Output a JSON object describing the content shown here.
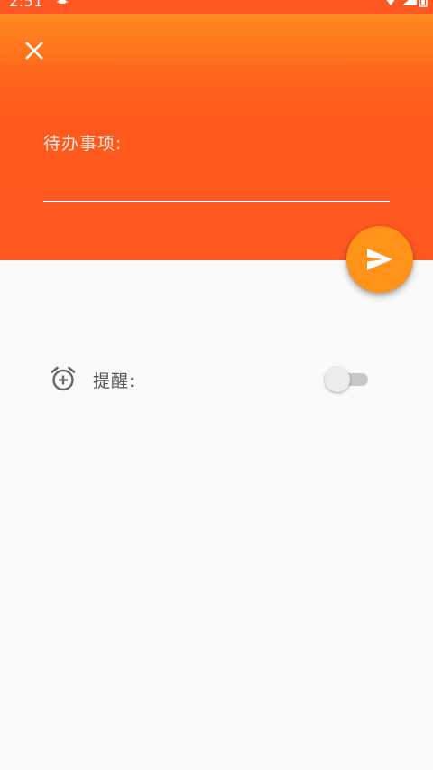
{
  "status_bar": {
    "time": "2:51",
    "background": "#ff5722",
    "icons": [
      "android-debug-icon",
      "wifi-icon",
      "cell-signal-icon",
      "battery-icon"
    ]
  },
  "header": {
    "gradient_top": "#ff8a1f",
    "gradient_bottom": "#ff5722",
    "close_icon": "close-icon",
    "todo_label": "待办事项:",
    "todo_input_value": "",
    "todo_input_placeholder": ""
  },
  "fab": {
    "icon": "send-icon",
    "color": "#ff9218"
  },
  "reminder": {
    "icon": "alarm-add-icon",
    "label": "提醒:",
    "enabled": false
  }
}
